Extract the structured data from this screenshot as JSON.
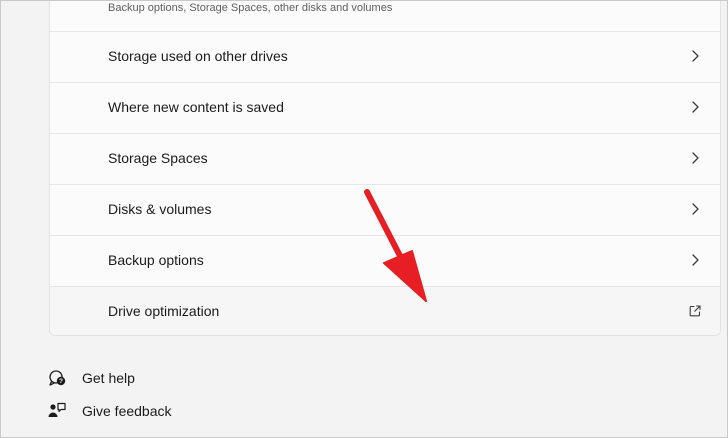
{
  "storage_card": {
    "subtitle": "Backup options, Storage Spaces, other disks and volumes",
    "rows": [
      {
        "label": "Storage used on other drives",
        "icon": "chevron-right-icon"
      },
      {
        "label": "Where new content is saved",
        "icon": "chevron-right-icon"
      },
      {
        "label": "Storage Spaces",
        "icon": "chevron-right-icon"
      },
      {
        "label": "Disks & volumes",
        "icon": "chevron-right-icon"
      },
      {
        "label": "Backup options",
        "icon": "chevron-right-icon"
      },
      {
        "label": "Drive optimization",
        "icon": "external-link-icon"
      }
    ]
  },
  "footer": {
    "help_label": "Get help",
    "feedback_label": "Give feedback"
  },
  "annotation": {
    "arrow_color": "#e81e25"
  }
}
